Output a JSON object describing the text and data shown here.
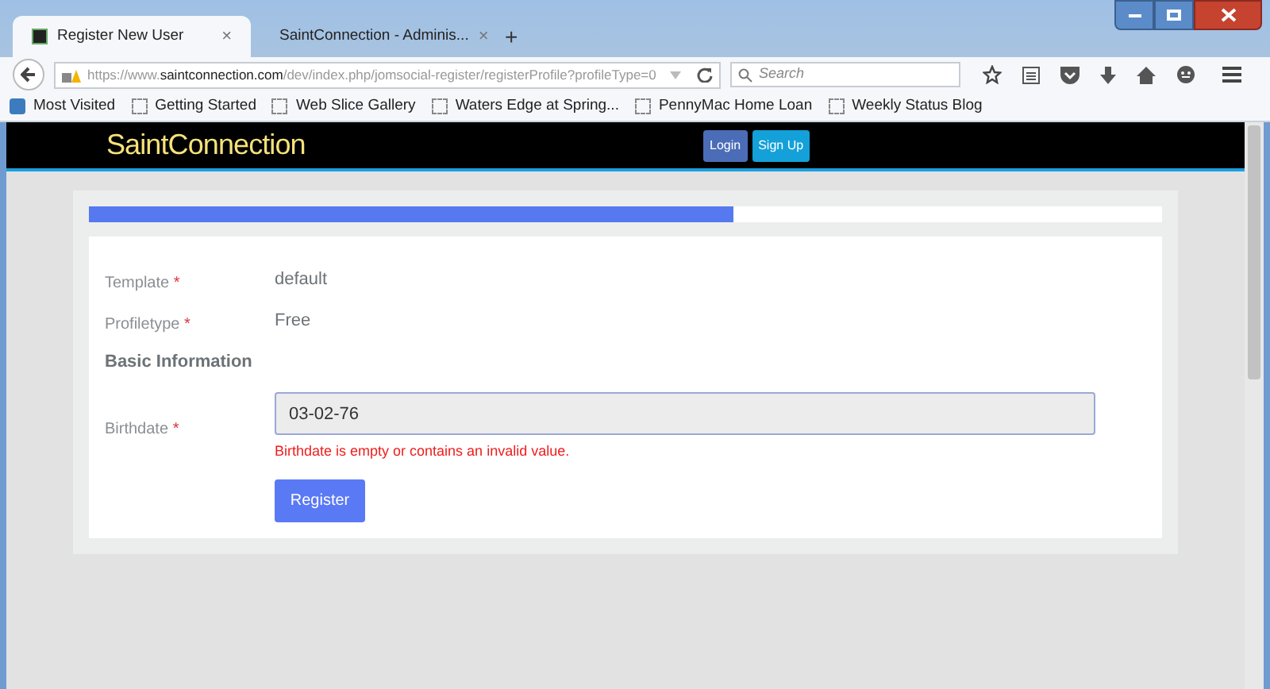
{
  "browser": {
    "tabs": [
      {
        "title": "Register New User",
        "selected": true,
        "close": "×"
      },
      {
        "title": "SaintConnection - Adminis...",
        "selected": false,
        "close": "×"
      }
    ],
    "new_tab": "+",
    "url": {
      "prefix": "https://www.",
      "domain": "saintconnection.com",
      "path": "/dev/index.php/jomsocial-register/registerProfile?profileType=0"
    },
    "search": {
      "placeholder": "Search"
    },
    "bookmarks": [
      {
        "label": "Most Visited",
        "kind": "special"
      },
      {
        "label": "Getting Started",
        "kind": "page"
      },
      {
        "label": "Web Slice Gallery",
        "kind": "page"
      },
      {
        "label": "Waters Edge at Spring...",
        "kind": "page"
      },
      {
        "label": "PennyMac Home Loan",
        "kind": "page"
      },
      {
        "label": "Weekly Status Blog",
        "kind": "page"
      }
    ]
  },
  "site": {
    "logo": "SaintConnection",
    "buttons": [
      {
        "label": "Login",
        "kind": "login"
      },
      {
        "label": "Sign Up",
        "kind": "signup"
      }
    ]
  },
  "progress": {
    "level": 0.6
  },
  "form": {
    "fields": [
      {
        "kind": "static",
        "label": "Template",
        "required_mark": "*",
        "value": "default"
      },
      {
        "kind": "static",
        "label": "Profiletype",
        "required_mark": "*",
        "value": "Free"
      },
      {
        "kind": "heading",
        "label": "Basic Information"
      },
      {
        "kind": "input",
        "label": "Birthdate",
        "required_mark": "*",
        "value": "03-02-76",
        "error": "Birthdate is empty or contains an invalid value."
      }
    ],
    "submit": "Register"
  }
}
